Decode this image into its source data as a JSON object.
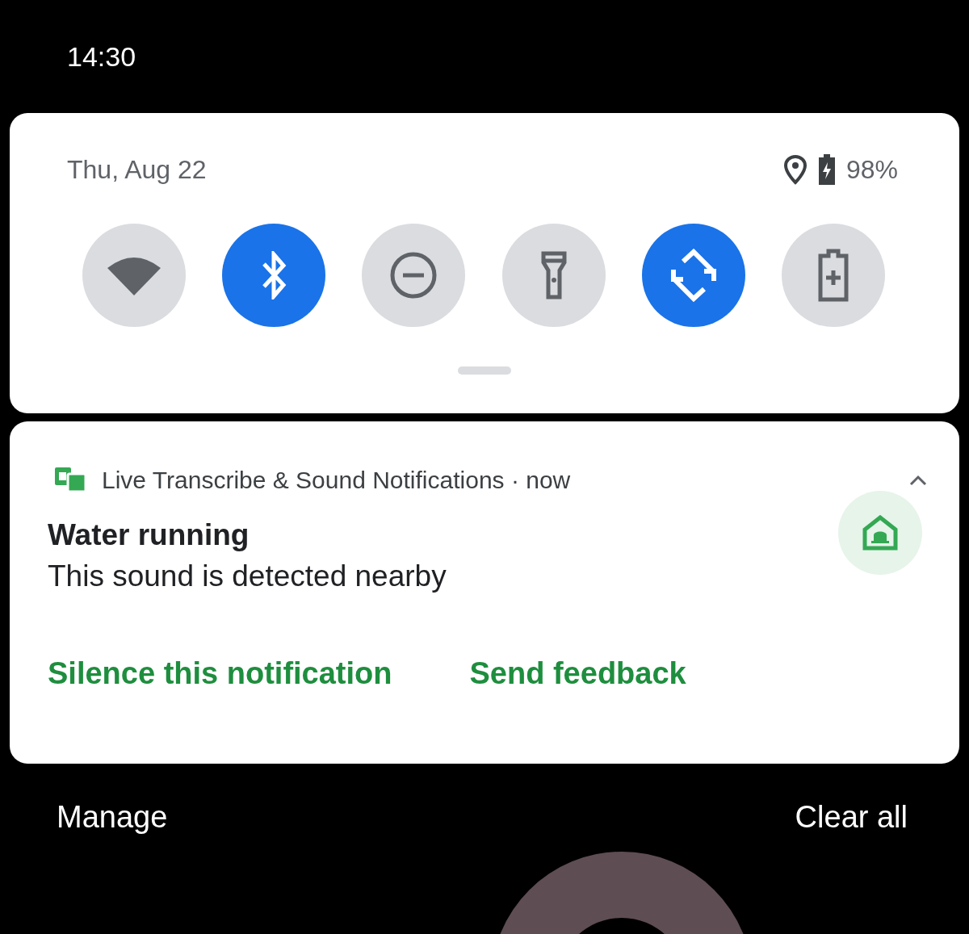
{
  "status_bar": {
    "time": "14:30"
  },
  "quick_settings": {
    "date": "Thu, Aug 22",
    "battery": "98%",
    "tiles": [
      {
        "kind": "wifi",
        "on": false
      },
      {
        "kind": "bluetooth",
        "on": true
      },
      {
        "kind": "do_not_disturb",
        "on": false
      },
      {
        "kind": "flashlight",
        "on": false
      },
      {
        "kind": "auto_rotate",
        "on": true
      },
      {
        "kind": "battery_saver",
        "on": false
      }
    ]
  },
  "notification": {
    "app": "Live Transcribe & Sound Notifications",
    "separator": "·",
    "time": "now",
    "expanded": true,
    "title": "Water running",
    "body": "This sound is detected nearby",
    "actions": [
      "Silence this notification",
      "Send feedback"
    ]
  },
  "footer": {
    "manage": "Manage",
    "clear_all": "Clear all"
  }
}
